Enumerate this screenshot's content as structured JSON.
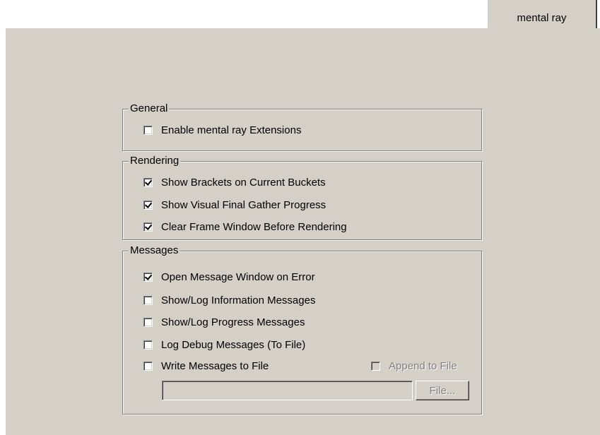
{
  "tab": {
    "label": "mental ray"
  },
  "groups": {
    "general": {
      "title": "General",
      "items": [
        {
          "label": "Enable mental ray Extensions",
          "checked": false
        }
      ]
    },
    "rendering": {
      "title": "Rendering",
      "items": [
        {
          "label": "Show Brackets on Current Buckets",
          "checked": true
        },
        {
          "label": "Show Visual Final Gather Progress",
          "checked": true
        },
        {
          "label": "Clear Frame Window Before Rendering",
          "checked": true
        }
      ]
    },
    "messages": {
      "title": "Messages",
      "items": [
        {
          "label": "Open Message Window on Error",
          "checked": true
        },
        {
          "label": "Show/Log Information Messages",
          "checked": false
        },
        {
          "label": "Show/Log Progress Messages",
          "checked": false
        },
        {
          "label": "Log Debug Messages (To File)",
          "checked": false
        },
        {
          "label": "Write Messages to File",
          "checked": false
        }
      ],
      "append_to_file": {
        "label": "Append to File",
        "checked": false,
        "enabled": false
      },
      "file_path": {
        "value": ""
      },
      "file_button": {
        "label": "File...",
        "enabled": false
      }
    }
  },
  "colors": {
    "panel": "#d4d0c8",
    "shadow": "#808080",
    "highlight": "#ffffff"
  }
}
